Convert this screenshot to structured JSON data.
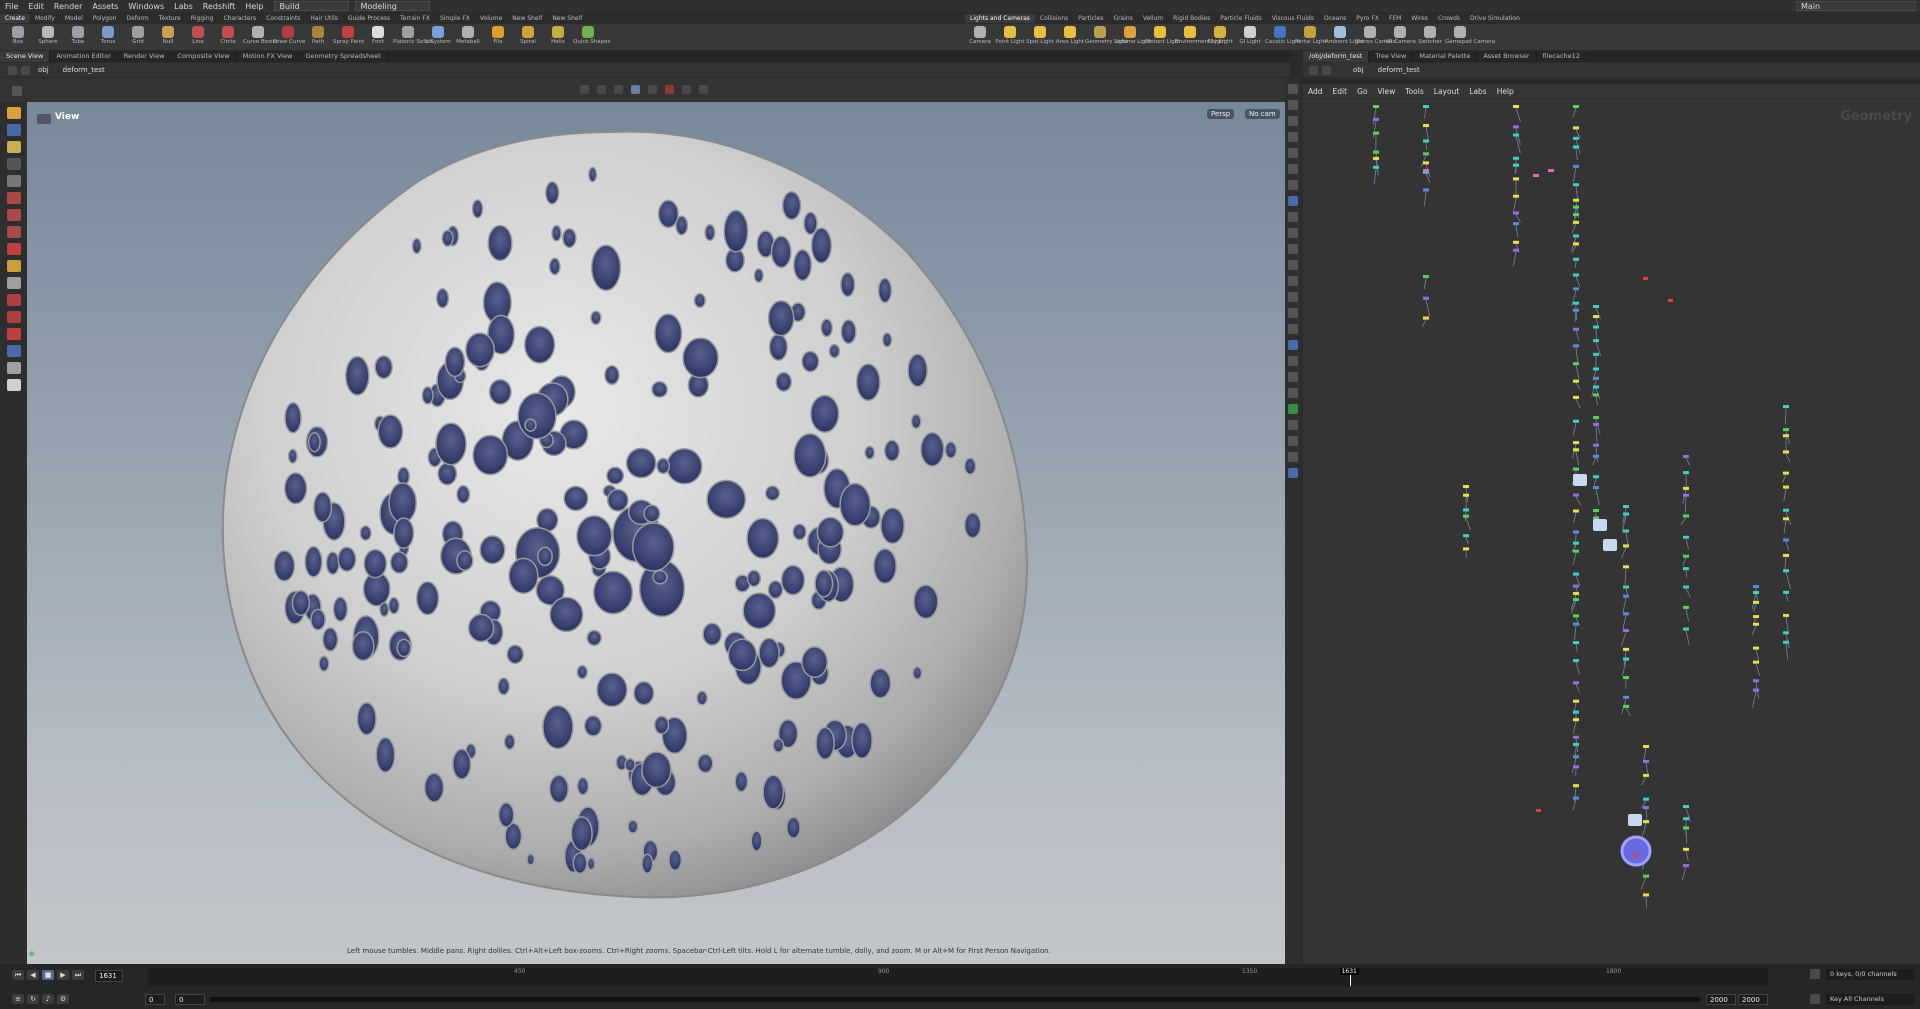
{
  "menubar": {
    "items": [
      "File",
      "Edit",
      "Render",
      "Assets",
      "Windows",
      "Labs",
      "Redshift",
      "Help"
    ],
    "build_dropdown": "Build",
    "desktop_dropdown": "Modeling",
    "main_dropdown": "Main"
  },
  "shelf_tabs_left": [
    "Create",
    "Modify",
    "Model",
    "Polygon",
    "Deform",
    "Texture",
    "Rigging",
    "Characters",
    "Constraints",
    "Hair Utils",
    "Guide Process",
    "Terrain FX",
    "Simple FX",
    "Volume",
    "New Shelf",
    "New Shelf"
  ],
  "shelf_tools_left": [
    "Box",
    "Sphere",
    "Tube",
    "Torus",
    "Grid",
    "Null",
    "Line",
    "Circle",
    "Curve Bezier",
    "Draw Curve",
    "Path",
    "Spray Paint",
    "Font",
    "Platonic Solids",
    "L-System",
    "Metaball",
    "File",
    "Spiral",
    "Helix",
    "Quick Shapes"
  ],
  "shelf_tabs_right": [
    "Lights and Cameras",
    "Collisions",
    "Particles",
    "Grains",
    "Vellum",
    "Rigid Bodies",
    "Particle Fluids",
    "Viscous Fluids",
    "Oceans",
    "Pyro FX",
    "FEM",
    "Wires",
    "Crowds",
    "Drive Simulation"
  ],
  "shelf_tools_right": [
    "Camera",
    "Point Light",
    "Spot Light",
    "Area Light",
    "Geometry Light",
    "Volume Light",
    "Distant Light",
    "Environment Light",
    "Sky Light",
    "GI Light",
    "Caustic Light",
    "Portal Light",
    "Ambient Light",
    "Stereo Camera",
    "VR Camera",
    "Switcher",
    "Gamepad Camera"
  ],
  "left_pane_tabs": [
    "Scene View",
    "Animation Editor",
    "Render View",
    "Composite View",
    "Motion FX View",
    "Geometry Spreadsheet"
  ],
  "right_pane_tabs": [
    "/obj/deform_test",
    "Tree View",
    "Material Palette",
    "Asset Browser",
    "filecache12"
  ],
  "left_path": {
    "context": "obj",
    "node": "deform_test"
  },
  "right_path": {
    "context": "obj",
    "node": "deform_test"
  },
  "viewport": {
    "label": "View",
    "persp_btn": "Persp",
    "cam_btn": "No cam",
    "status_hint": "Left mouse tumbles. Middle pans. Right dollies. Ctrl+Alt+Left box-zooms. Ctrl+Right zooms. Spacebar-Ctrl-Left tilts. Hold L for alternate tumble, dolly, and zoom. M or Alt+M for First Person Navigation."
  },
  "network": {
    "menu": [
      "Add",
      "Edit",
      "Go",
      "View",
      "Tools",
      "Layout",
      "Labs",
      "Help"
    ],
    "watermark": "Geometry"
  },
  "timeline": {
    "current_frame": "1631",
    "ticks": [
      "450",
      "900",
      "1350",
      "1800"
    ],
    "frame_marker": "1631",
    "start_frame": "0",
    "start_frame2": "0",
    "end_frame": "2000",
    "end_frame2": "2000",
    "keys_info": "0 keys, 0/0 channels",
    "key_all": "Key All Channels"
  },
  "colors": {
    "node_yellow": "#e8e04a",
    "node_cyan": "#3fd0c0",
    "node_green": "#5ad05a",
    "node_blue": "#5a8ad8",
    "node_purple": "#9a6ae0",
    "node_pink": "#e06ac0",
    "node_red": "#e04040",
    "playhead": "#ffffff"
  }
}
